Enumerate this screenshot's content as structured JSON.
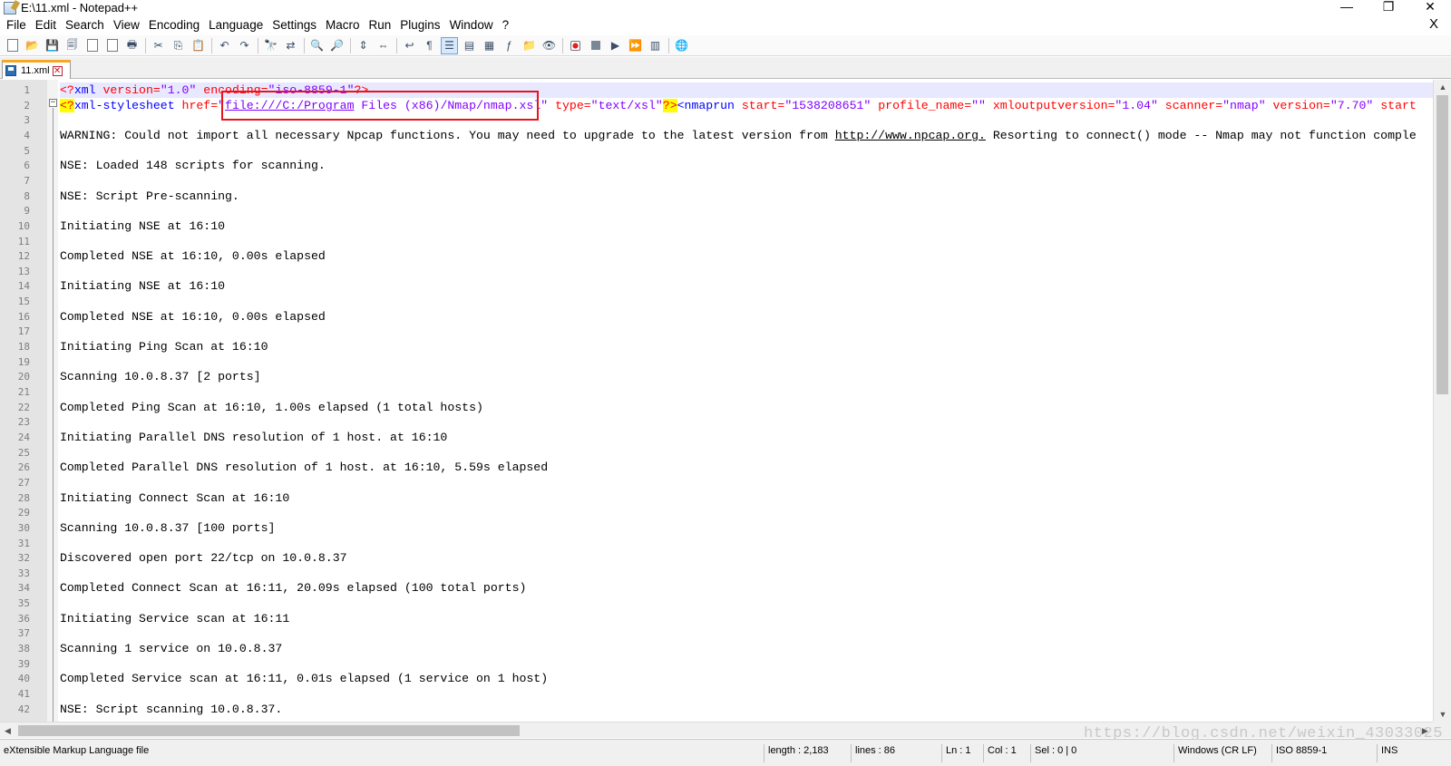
{
  "window": {
    "title": "E:\\11.xml - Notepad++",
    "controls": {
      "minimize": "—",
      "maximize": "❐",
      "close": "✕"
    }
  },
  "menu": [
    "File",
    "Edit",
    "Search",
    "View",
    "Encoding",
    "Language",
    "Settings",
    "Macro",
    "Run",
    "Plugins",
    "Window",
    "?"
  ],
  "menu_close": "X",
  "toolbar": {
    "buttons": [
      "new-file",
      "open-file",
      "save",
      "save-all",
      "close",
      "close-all",
      "print",
      "cut",
      "copy",
      "paste",
      "undo",
      "redo",
      "find",
      "replace",
      "zoom-in",
      "zoom-out",
      "sync-vertical",
      "sync-horizontal",
      "word-wrap",
      "show-all-characters",
      "indent-guide",
      "user-defined-language",
      "document-map",
      "function-list",
      "folder-as-workspace",
      "monitoring",
      "record-macro",
      "stop-recording",
      "playback-macro",
      "run-macro-multiple",
      "save-macro",
      "launch-in-browser"
    ]
  },
  "tab": {
    "label": "11.xml",
    "close": "✕"
  },
  "editor": {
    "line_numbers": [
      "1",
      "2",
      "3",
      "4",
      "5",
      "6",
      "7",
      "8",
      "9",
      "10",
      "11",
      "12",
      "13",
      "14",
      "15",
      "16",
      "17",
      "18",
      "19",
      "20",
      "21",
      "22",
      "23",
      "24",
      "25",
      "26",
      "27",
      "28",
      "29",
      "30",
      "31",
      "32",
      "33",
      "34",
      "35",
      "36",
      "37",
      "38",
      "39",
      "40",
      "41",
      "42"
    ],
    "line1": {
      "open": "<?",
      "name": "xml",
      "attr1": " version=",
      "val1": "\"1.0\"",
      "attr2": " encoding=",
      "val2": "\"iso-8859-1\"",
      "close": "?>"
    },
    "line2": {
      "open": "<?",
      "name": "xml-stylesheet",
      "attr1": " href=",
      "q1": "\"",
      "link1": "file:///C:/Program",
      "rest1": " Files (x86)/Nmap/nmap.xsl\"",
      "attr2": " type=",
      "val2": "\"text/xsl\"",
      "close": "?>",
      "tag_open": "<",
      "tag_name": "nmaprun",
      "attr3": " start=",
      "val3": "\"1538208651\"",
      "attr4": " profile_name=",
      "val4": "\"\"",
      "attr5": " xmloutputversion=",
      "val5": "\"1.04\"",
      "attr6": " scanner=",
      "val6": "\"nmap\"",
      "attr7": " version=",
      "val7": "\"7.70\"",
      "attr8": " start"
    },
    "line4": {
      "before": "WARNING: Could not import all necessary Npcap functions. You may need to upgrade to the latest version from ",
      "url": "http://www.npcap.org.",
      "after": " Resorting to connect() mode -- Nmap may not function comple"
    },
    "text_lines": [
      {
        "n": 6,
        "text": "NSE: Loaded 148 scripts for scanning."
      },
      {
        "n": 8,
        "text": "NSE: Script Pre-scanning."
      },
      {
        "n": 10,
        "text": "Initiating NSE at 16:10"
      },
      {
        "n": 12,
        "text": "Completed NSE at 16:10, 0.00s elapsed"
      },
      {
        "n": 14,
        "text": "Initiating NSE at 16:10"
      },
      {
        "n": 16,
        "text": "Completed NSE at 16:10, 0.00s elapsed"
      },
      {
        "n": 18,
        "text": "Initiating Ping Scan at 16:10"
      },
      {
        "n": 20,
        "text": "Scanning 10.0.8.37 [2 ports]"
      },
      {
        "n": 22,
        "text": "Completed Ping Scan at 16:10, 1.00s elapsed (1 total hosts)"
      },
      {
        "n": 24,
        "text": "Initiating Parallel DNS resolution of 1 host. at 16:10"
      },
      {
        "n": 26,
        "text": "Completed Parallel DNS resolution of 1 host. at 16:10, 5.59s elapsed"
      },
      {
        "n": 28,
        "text": "Initiating Connect Scan at 16:10"
      },
      {
        "n": 30,
        "text": "Scanning 10.0.8.37 [100 ports]"
      },
      {
        "n": 32,
        "text": "Discovered open port 22/tcp on 10.0.8.37"
      },
      {
        "n": 34,
        "text": "Completed Connect Scan at 16:11, 20.09s elapsed (100 total ports)"
      },
      {
        "n": 36,
        "text": "Initiating Service scan at 16:11"
      },
      {
        "n": 38,
        "text": "Scanning 1 service on 10.0.8.37"
      },
      {
        "n": 40,
        "text": "Completed Service scan at 16:11, 0.01s elapsed (1 service on 1 host)"
      },
      {
        "n": 42,
        "text": "NSE: Script scanning 10.0.8.37."
      }
    ]
  },
  "watermark": "https://blog.csdn.net/weixin_43033025",
  "status": {
    "file_type": "eXtensible Markup Language file",
    "length": "length : 2,183",
    "lines": "lines : 86",
    "ln": "Ln : 1",
    "col": "Col : 1",
    "sel": "Sel : 0 | 0",
    "eol": "Windows (CR LF)",
    "encoding": "ISO 8859-1",
    "mode": "INS"
  },
  "colors": {
    "tag": "#ff0000",
    "element_name": "#0000ff",
    "attribute_value": "#8000ff",
    "highlight": "#ffff00",
    "annotation_box": "#e8141c",
    "active_tab": "#f5a623"
  }
}
